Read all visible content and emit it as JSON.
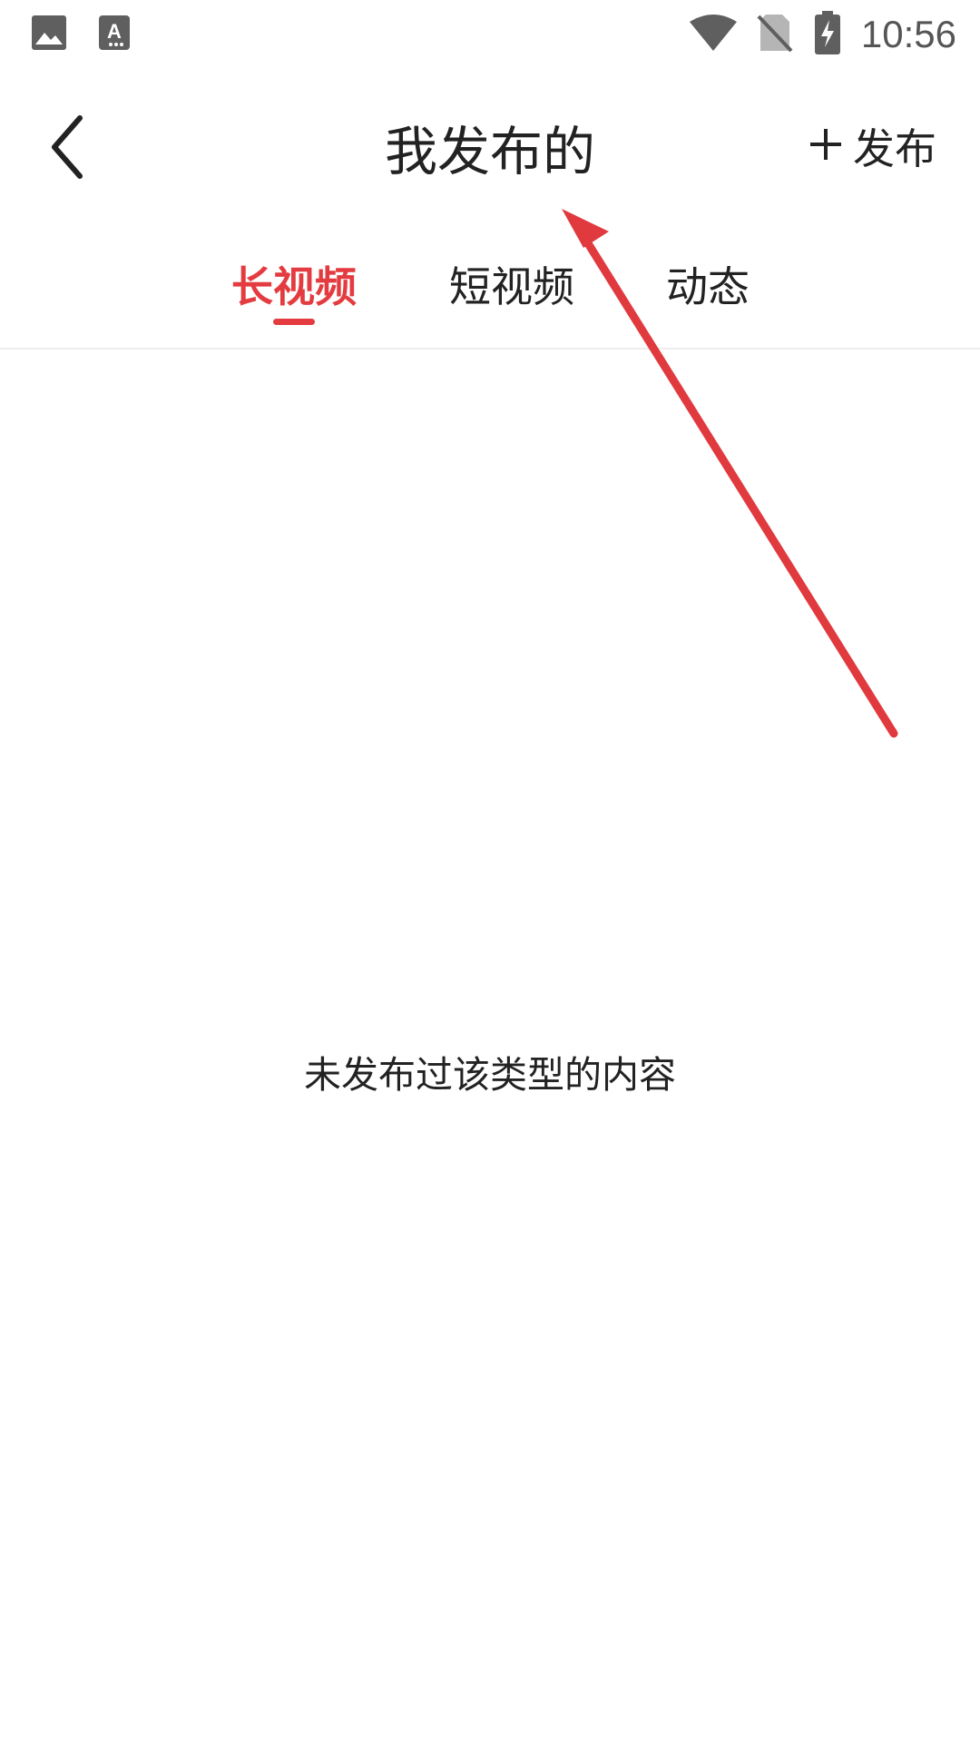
{
  "status_bar": {
    "time": "10:56",
    "icons": [
      "gallery-icon",
      "a-notification-icon",
      "wifi-icon",
      "no-sim-icon",
      "battery-charging-icon"
    ]
  },
  "header": {
    "title": "我发布的",
    "back_icon": "chevron-left-icon",
    "publish_icon": "plus-icon",
    "publish_label": "发布"
  },
  "tabs": [
    {
      "label": "长视频",
      "active": true
    },
    {
      "label": "短视频",
      "active": false
    },
    {
      "label": "动态",
      "active": false
    }
  ],
  "empty_state": {
    "message": "未发布过该类型的内容"
  },
  "colors": {
    "accent": "#e33b3f",
    "text": "#222222",
    "annotation_arrow": "#e0393e"
  }
}
